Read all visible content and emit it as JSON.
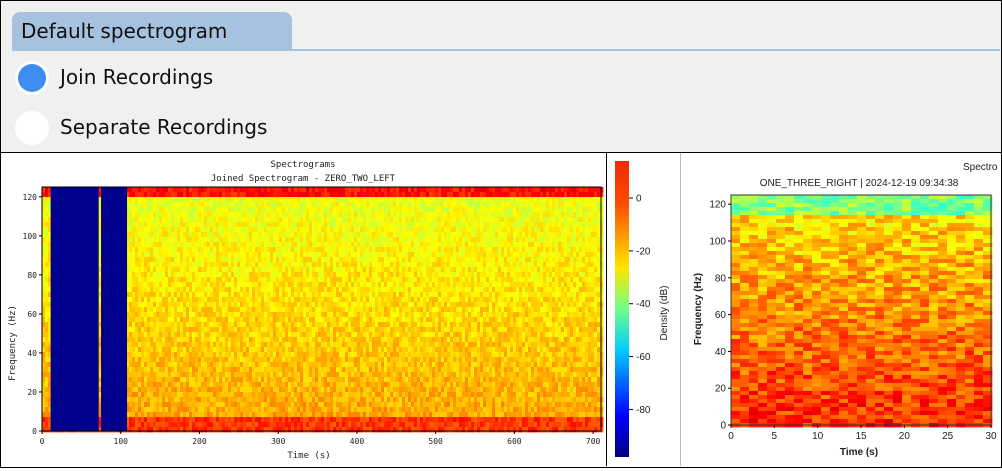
{
  "tab": {
    "label": "Default spectrogram"
  },
  "options": [
    {
      "label": "Join Recordings",
      "selected": true
    },
    {
      "label": "Separate Recordings",
      "selected": false
    }
  ],
  "colors": {
    "accent": "#3d8ef0",
    "tab": "#a6c2df"
  },
  "chart_data": [
    {
      "type": "heatmap",
      "suptitle": "Spectrograms",
      "title": "Joined Spectrogram - ZERO_TWO_LEFT",
      "xlabel": "Time (s)",
      "ylabel": "Frequency (Hz)",
      "xlim": [
        0,
        710
      ],
      "ylim": [
        0,
        125
      ],
      "xticks": [
        0,
        100,
        200,
        300,
        400,
        500,
        600,
        700
      ],
      "yticks": [
        0,
        20,
        40,
        60,
        80,
        100,
        120
      ],
      "gaps": [
        [
          11,
          72
        ],
        [
          75,
          108
        ]
      ],
      "ridge_bands": [
        [
          0,
          8
        ],
        [
          120,
          125
        ]
      ]
    },
    {
      "type": "colorbar",
      "label": "Density (dB)",
      "ticks": [
        0,
        -20,
        -40,
        -60,
        -80
      ],
      "range": [
        -98,
        14
      ]
    },
    {
      "type": "heatmap",
      "suptitle": "Spectro",
      "title": "ONE_THREE_RIGHT | 2024-12-19 09:34:38",
      "xlabel": "Time (s)",
      "ylabel": "Frequency (Hz)",
      "xlim": [
        0,
        30
      ],
      "ylim": [
        0,
        125
      ],
      "xticks": [
        0,
        5,
        10,
        15,
        20,
        25,
        30
      ],
      "yticks": [
        0,
        20,
        40,
        60,
        80,
        100,
        120
      ]
    }
  ]
}
